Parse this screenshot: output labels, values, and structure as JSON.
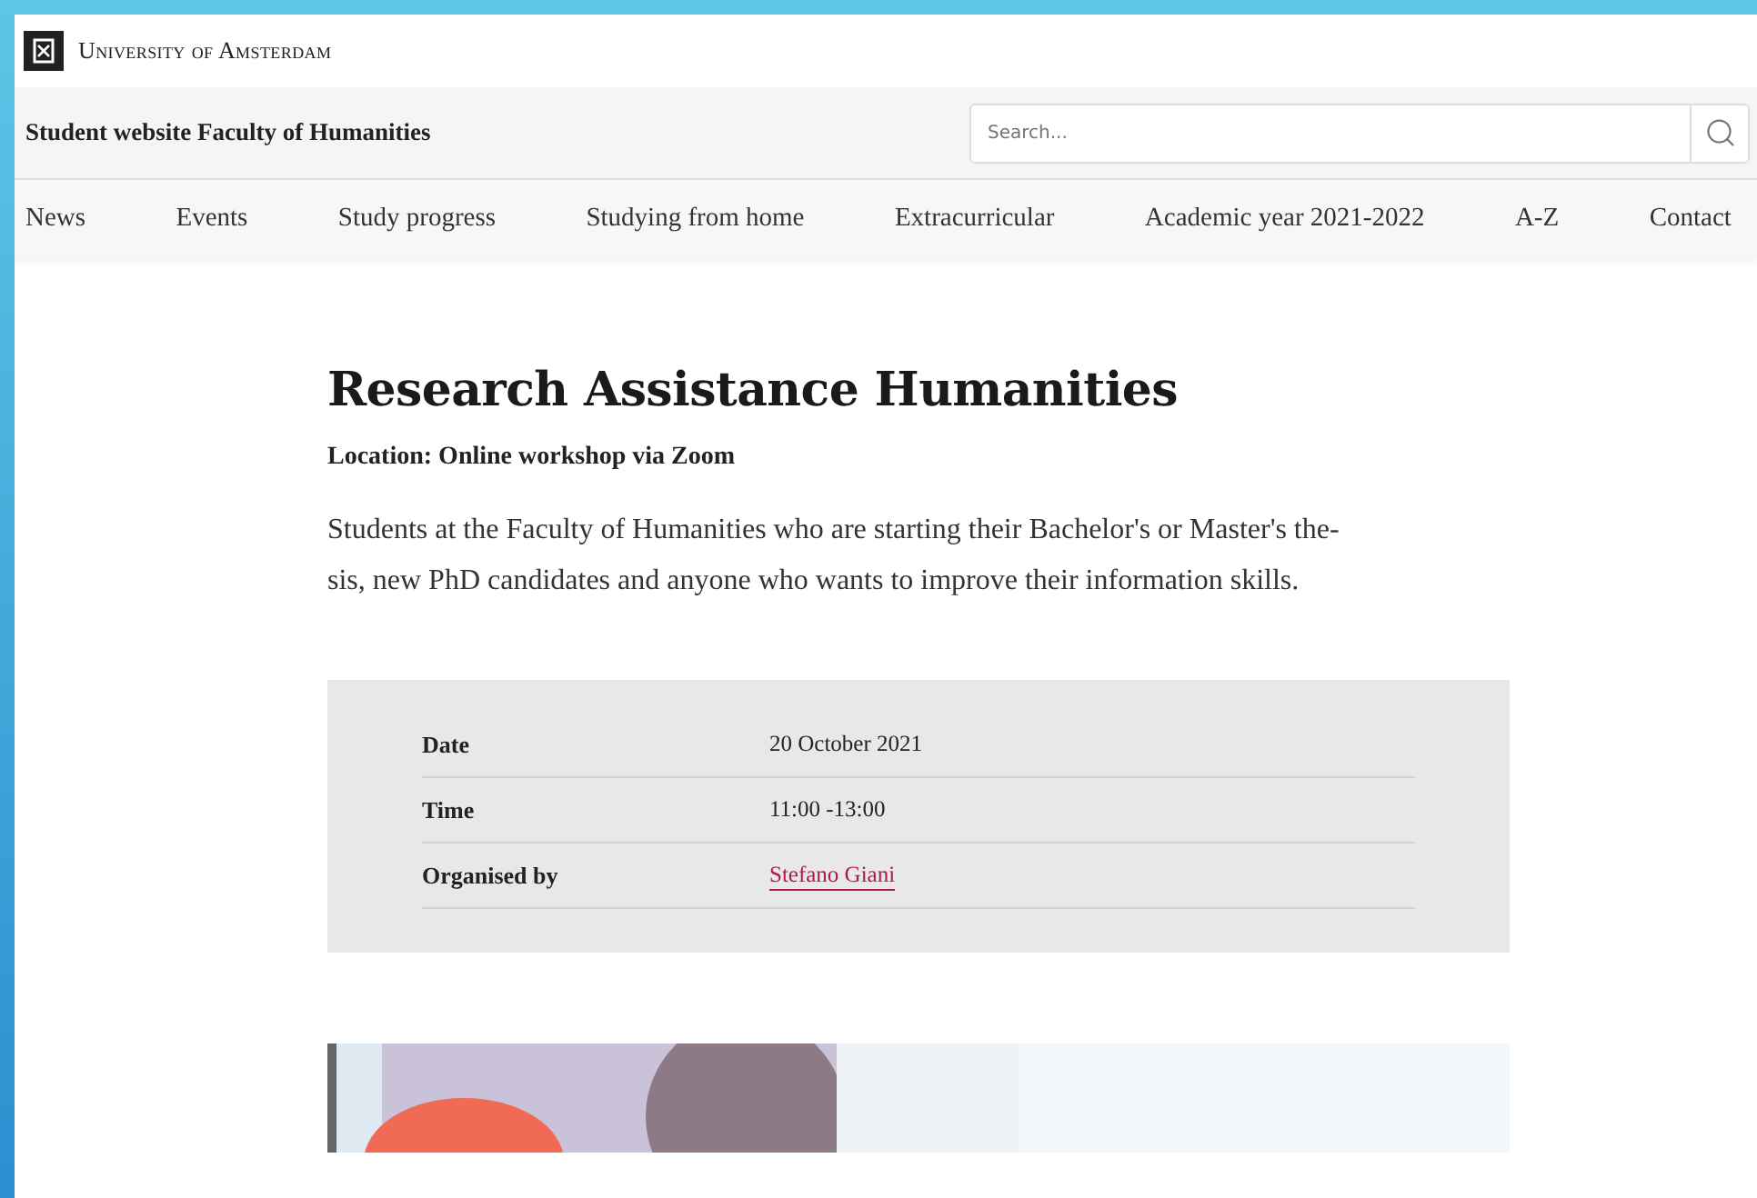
{
  "header": {
    "university": "University of Amsterdam",
    "site_title": "Student website Faculty of Humanities",
    "search": {
      "placeholder": "Search..."
    }
  },
  "nav": [
    "News",
    "Events",
    "Study progress",
    "Studying from home",
    "Extracurricular",
    "Academic year 2021-2022",
    "A-Z",
    "Contact"
  ],
  "article": {
    "title": "Research Assistance Humanities",
    "location": "Location: Online workshop via Zoom",
    "intro": "Students at the Faculty of Humanities who are starting their Bachelor's or Master's the-sis, new PhD candidates and anyone who wants to improve their information skills.",
    "details": [
      {
        "label": "Date",
        "value": "20 October 2021",
        "kind": "text"
      },
      {
        "label": "Time",
        "value": "11:00 -13:00",
        "kind": "text"
      },
      {
        "label": "Organised by",
        "value": "Stefano Giani",
        "kind": "link"
      }
    ]
  }
}
